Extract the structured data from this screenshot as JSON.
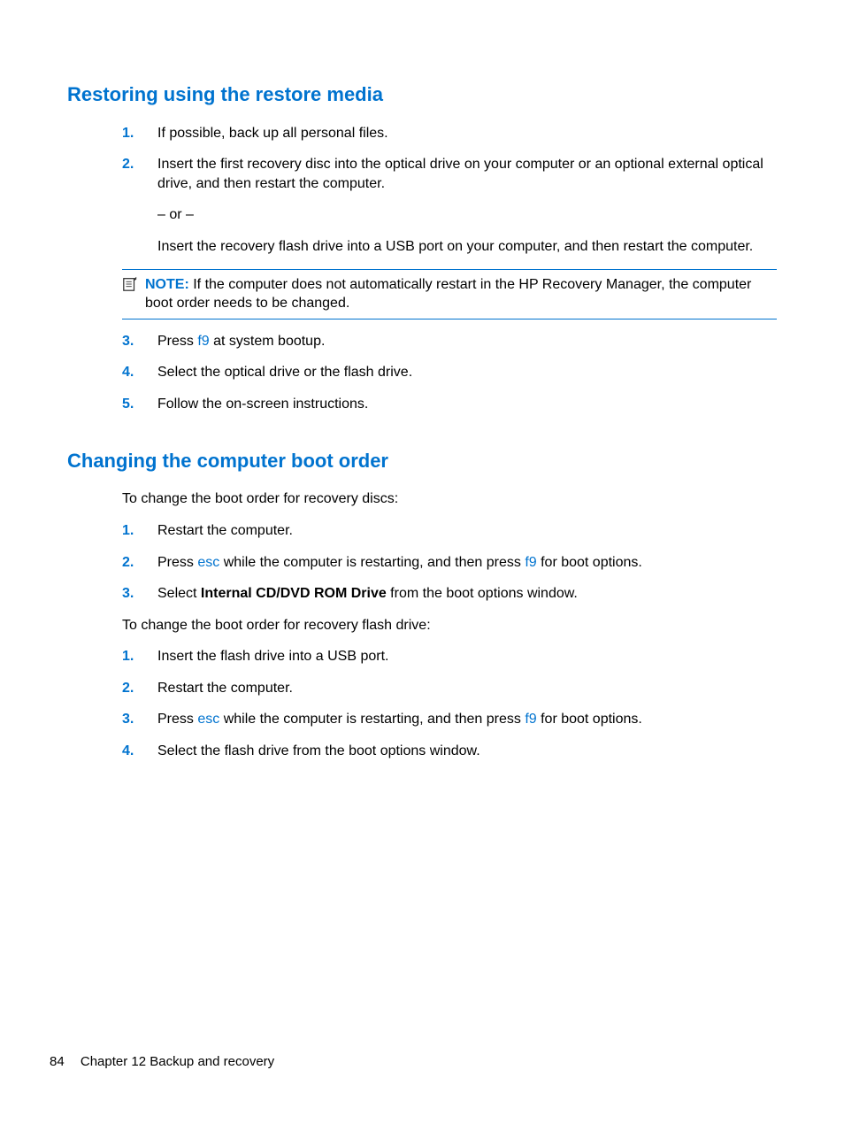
{
  "section1": {
    "heading": "Restoring using the restore media",
    "items": [
      {
        "num": "1.",
        "paras": [
          "If possible, back up all personal files."
        ]
      },
      {
        "num": "2.",
        "paras": [
          "Insert the first recovery disc into the optical drive on your computer or an optional external optical drive, and then restart the computer.",
          "– or –",
          "Insert the recovery flash drive into a USB port on your computer, and then restart the computer."
        ]
      }
    ],
    "note": {
      "label": "NOTE:",
      "text": "If the computer does not automatically restart in the HP Recovery Manager, the computer boot order needs to be changed."
    },
    "items_after": [
      {
        "num": "3.",
        "pre": "Press ",
        "key": "f9",
        "post": " at system bootup."
      },
      {
        "num": "4.",
        "text": "Select the optical drive or the flash drive."
      },
      {
        "num": "5.",
        "text": "Follow the on-screen instructions."
      }
    ]
  },
  "section2": {
    "heading": "Changing the computer boot order",
    "intro1": "To change the boot order for recovery discs:",
    "list1": [
      {
        "num": "1.",
        "text": "Restart the computer."
      },
      {
        "num": "2.",
        "pre": "Press ",
        "key1": "esc",
        "mid": " while the computer is restarting, and then press ",
        "key2": "f9",
        "post": " for boot options."
      },
      {
        "num": "3.",
        "pre": "Select ",
        "bold": "Internal CD/DVD ROM Drive",
        "post": " from the boot options window."
      }
    ],
    "intro2": "To change the boot order for recovery flash drive:",
    "list2": [
      {
        "num": "1.",
        "text": "Insert the flash drive into a USB port."
      },
      {
        "num": "2.",
        "text": "Restart the computer."
      },
      {
        "num": "3.",
        "pre": "Press ",
        "key1": "esc",
        "mid": " while the computer is restarting, and then press ",
        "key2": "f9",
        "post": " for boot options."
      },
      {
        "num": "4.",
        "text": "Select the flash drive from the boot options window."
      }
    ]
  },
  "footer": {
    "page": "84",
    "chapter": "Chapter 12   Backup and recovery"
  }
}
